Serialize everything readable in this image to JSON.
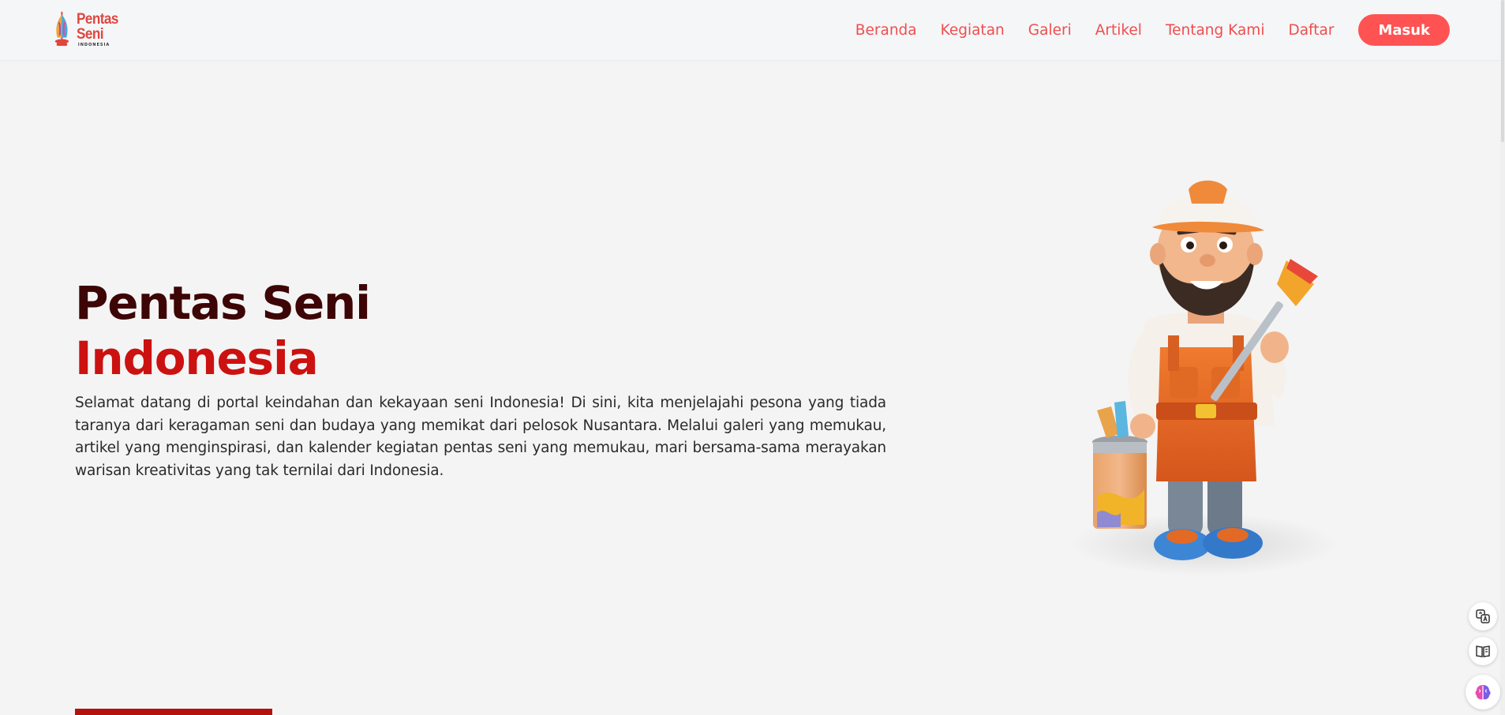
{
  "brand": {
    "name": "Pentas Seni",
    "sub": "INDONESIA",
    "primary_color": "#fe5352",
    "title_dark": "#3d0505",
    "title_red": "#cc1111"
  },
  "nav": {
    "items": [
      {
        "label": "Beranda"
      },
      {
        "label": "Kegiatan"
      },
      {
        "label": "Galeri"
      },
      {
        "label": "Artikel"
      },
      {
        "label": "Tentang Kami"
      },
      {
        "label": "Daftar"
      }
    ],
    "login_label": "Masuk"
  },
  "hero": {
    "title_line1": "Pentas Seni",
    "title_line2": "Indonesia",
    "description": "Selamat datang di portal keindahan dan kekayaan seni Indonesia! Di sini, kita menjelajahi pesona yang tiada taranya dari keragaman seni dan budaya yang memikat dari pelosok Nusantara. Melalui galeri yang memukau, artikel yang menginspirasi, dan kalender kegiatan pentas seni yang memukau, mari bersama-sama merayakan warisan kreativitas yang tak ternilai dari Indonesia.",
    "illustration": "painter-character-with-brush-and-paint-can"
  },
  "floating_tools": [
    {
      "icon": "translate-icon"
    },
    {
      "icon": "reader-icon"
    },
    {
      "icon": "ai-brain-icon"
    }
  ]
}
